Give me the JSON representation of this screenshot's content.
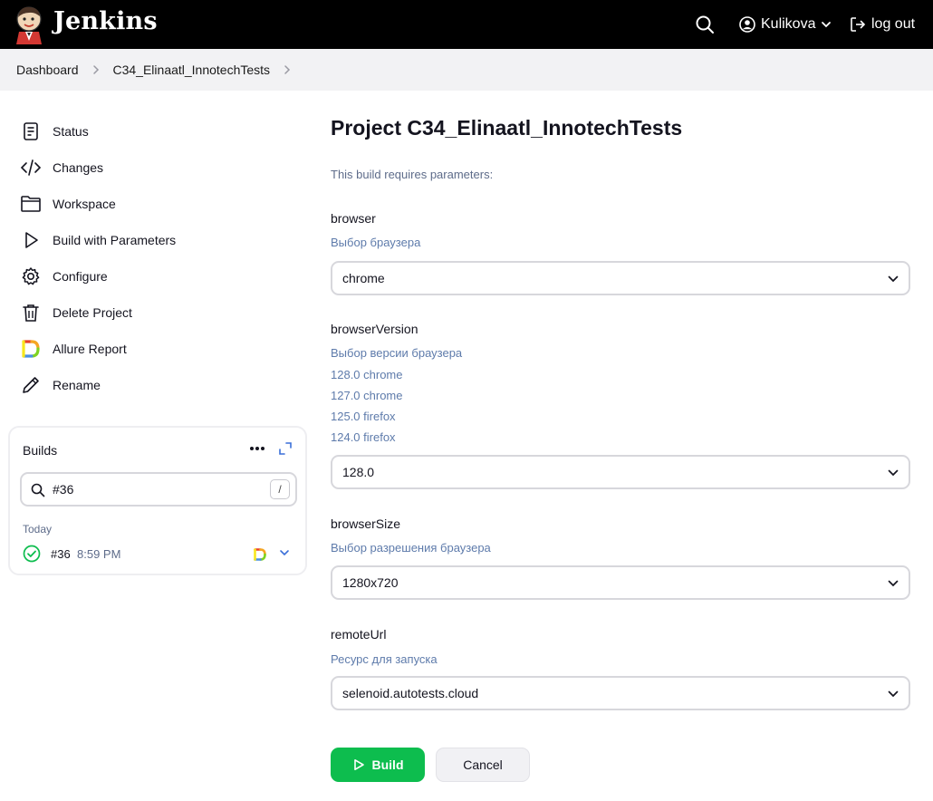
{
  "header": {
    "brand": "Jenkins",
    "user": "Kulikova",
    "logout": "log out"
  },
  "breadcrumb": [
    "Dashboard",
    "C34_Elinaatl_InnotechTests"
  ],
  "sidebar": {
    "items": [
      {
        "label": "Status",
        "icon": "notepad-icon"
      },
      {
        "label": "Changes",
        "icon": "code-icon"
      },
      {
        "label": "Workspace",
        "icon": "folder-icon"
      },
      {
        "label": "Build with Parameters",
        "icon": "play-icon"
      },
      {
        "label": "Configure",
        "icon": "gear-icon"
      },
      {
        "label": "Delete Project",
        "icon": "trash-icon"
      },
      {
        "label": "Allure Report",
        "icon": "allure-icon"
      },
      {
        "label": "Rename",
        "icon": "pencil-icon"
      }
    ]
  },
  "builds": {
    "title": "Builds",
    "search_value": "#36",
    "search_key": "/",
    "day": "Today",
    "rows": [
      {
        "number": "#36",
        "time": "8:59 PM",
        "status": "success"
      }
    ]
  },
  "main": {
    "title": "Project C34_Elinaatl_InnotechTests",
    "requires": "This build requires parameters:",
    "params": [
      {
        "name": "browser",
        "desc": [
          "Выбор браузера"
        ],
        "value": "chrome"
      },
      {
        "name": "browserVersion",
        "desc": [
          "Выбор версии браузера",
          "128.0 chrome",
          "127.0 chrome",
          "125.0 firefox",
          "124.0 firefox"
        ],
        "value": "128.0"
      },
      {
        "name": "browserSize",
        "desc": [
          "Выбор разрешения браузера"
        ],
        "value": "1280x720"
      },
      {
        "name": "remoteUrl",
        "desc": [
          "Ресурс для запуска"
        ],
        "value": "selenoid.autotests.cloud"
      }
    ],
    "build_button": "Build",
    "cancel_button": "Cancel"
  },
  "colors": {
    "header_bg": "#000000",
    "build_green": "#0dbd4e",
    "link_blue": "#5e7bab"
  }
}
